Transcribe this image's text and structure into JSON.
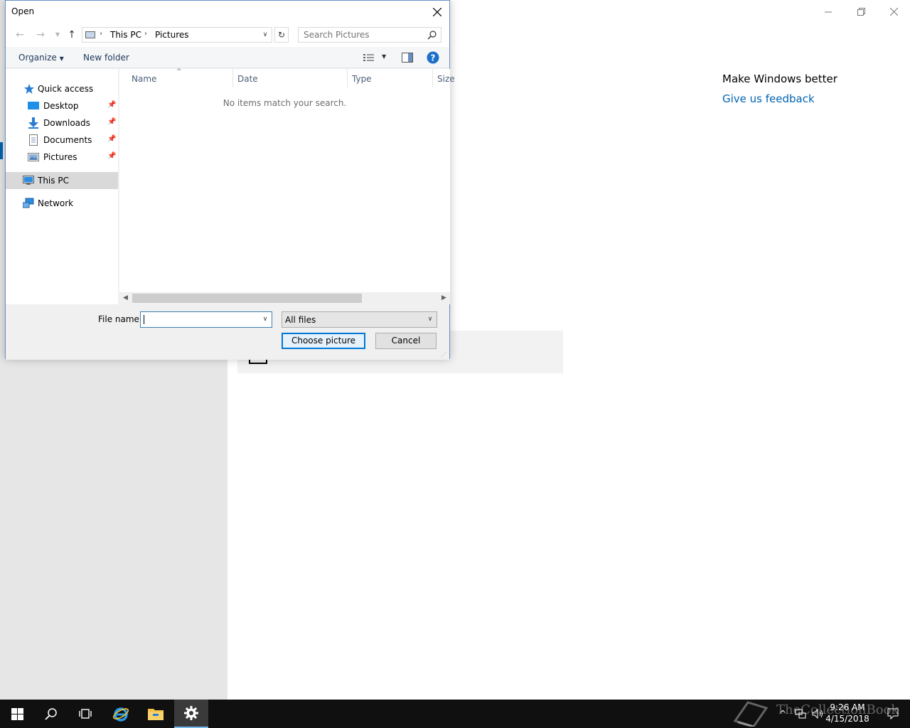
{
  "settings": {
    "make_better_title": "Make Windows better",
    "feedback_link": "Give us feedback"
  },
  "dialog": {
    "title": "Open",
    "address": {
      "crumbs": [
        "This PC",
        "Pictures"
      ]
    },
    "search_placeholder": "Search Pictures",
    "toolbar": {
      "organize": "Organize",
      "new_folder": "New folder"
    },
    "nav": {
      "quick_access": "Quick access",
      "desktop": "Desktop",
      "downloads": "Downloads",
      "documents": "Documents",
      "pictures": "Pictures",
      "this_pc": "This PC",
      "network": "Network"
    },
    "columns": [
      "Name",
      "Date",
      "Type",
      "Size"
    ],
    "empty_message": "No items match your search.",
    "file_name_label": "File name:",
    "file_name_value": "",
    "file_type": "All files",
    "buttons": {
      "choose": "Choose picture",
      "cancel": "Cancel"
    }
  },
  "taskbar": {
    "time": "9:26 AM",
    "date": "4/15/2018",
    "watermark": "TheCollectionBook"
  },
  "colors": {
    "accent": "#0063b1",
    "link": "#0063b1",
    "taskbar": "#101010",
    "selection": "#d9d9d9"
  }
}
